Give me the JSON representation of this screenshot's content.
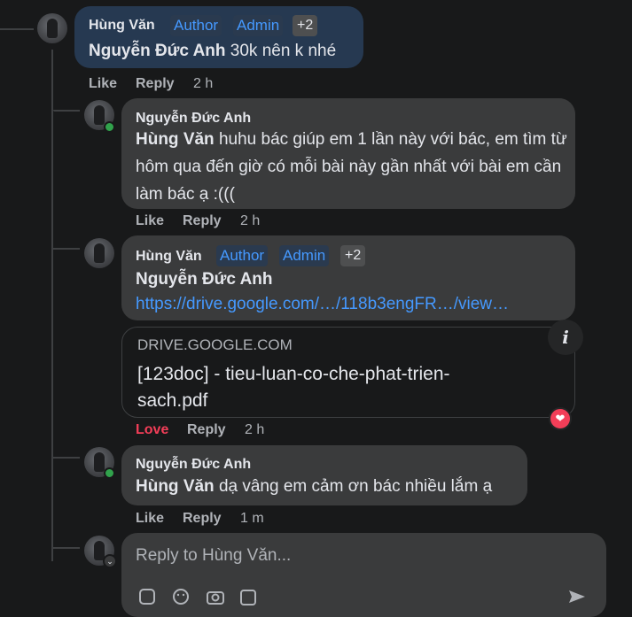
{
  "comment1": {
    "author": "Hùng Văn",
    "badges": [
      "Author",
      "Admin"
    ],
    "extra_badges": "+2",
    "mention": "Nguyễn Đức Anh",
    "text": " 30k nên k nhé",
    "actions": {
      "like": "Like",
      "reply": "Reply",
      "time": "2 h"
    }
  },
  "reply1": {
    "author": "Nguyễn Đức Anh",
    "mention": "Hùng Văn",
    "text": " huhu bác giúp em 1 lần này với bác, em tìm từ hôm qua đến giờ có mỗi bài này gần nhất với bài em cần làm bác ạ :(((",
    "actions": {
      "like": "Like",
      "reply": "Reply",
      "time": "2 h"
    }
  },
  "reply2": {
    "author": "Hùng Văn",
    "badges": [
      "Author",
      "Admin"
    ],
    "extra_badges": "+2",
    "mention": "Nguyễn Đức Anh",
    "link": "https://drive.google.com/…/118b3engFR…/view…",
    "preview": {
      "domain": "DRIVE.GOOGLE.COM",
      "title": "[123doc] - tieu-luan-co-che-phat-trien-sach.pdf"
    },
    "actions": {
      "love": "Love",
      "reply": "Reply",
      "time": "2 h"
    }
  },
  "reply3": {
    "author": "Nguyễn Đức Anh",
    "mention": "Hùng Văn",
    "text": " dạ vâng em cảm ơn bác nhiều lắm ạ",
    "actions": {
      "like": "Like",
      "reply": "Reply",
      "time": "1 m"
    }
  },
  "composer": {
    "placeholder": "Reply to Hùng Văn...",
    "tools": [
      "sticker-icon",
      "emoji-icon",
      "camera-icon",
      "gif-icon",
      "send-icon"
    ]
  },
  "colors": {
    "background": "#18191a",
    "bubble": "#3a3b3c",
    "highlight_bubble": "#263951",
    "link": "#4599ff",
    "love": "#f33e58",
    "online": "#31a24c"
  }
}
